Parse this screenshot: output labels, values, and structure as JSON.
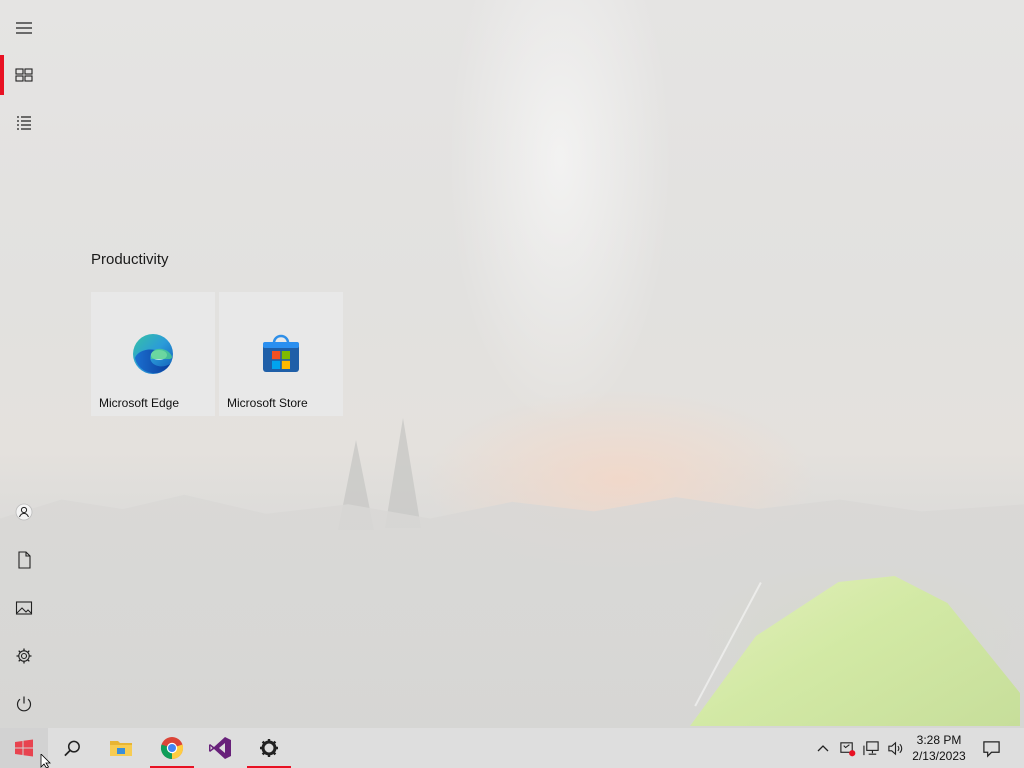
{
  "start_menu": {
    "rail": {
      "items": [
        {
          "name": "Expand",
          "icon": "hamburger-icon"
        },
        {
          "name": "Pinned tiles",
          "icon": "tiles-icon",
          "active": true
        },
        {
          "name": "All apps",
          "icon": "list-icon"
        },
        {
          "name": "Account",
          "icon": "user-icon"
        },
        {
          "name": "Documents",
          "icon": "document-icon"
        },
        {
          "name": "Pictures",
          "icon": "pictures-icon"
        },
        {
          "name": "Settings",
          "icon": "gear-icon"
        },
        {
          "name": "Power",
          "icon": "power-icon"
        }
      ]
    },
    "group": {
      "title": "Productivity",
      "tiles": [
        {
          "label": "Microsoft Edge",
          "icon": "edge-icon"
        },
        {
          "label": "Microsoft Store",
          "icon": "store-icon"
        }
      ]
    }
  },
  "taskbar": {
    "apps": [
      {
        "name": "Start",
        "icon": "windows-logo-icon"
      },
      {
        "name": "Search",
        "icon": "search-icon"
      },
      {
        "name": "File Explorer",
        "icon": "folder-icon"
      },
      {
        "name": "Google Chrome",
        "icon": "chrome-icon",
        "running": true
      },
      {
        "name": "Visual Studio",
        "icon": "visual-studio-icon"
      },
      {
        "name": "Settings",
        "icon": "gear-icon",
        "running": true
      }
    ],
    "tray": {
      "icons": [
        "chevron-up-icon",
        "defender-icon",
        "network-icon",
        "volume-icon"
      ],
      "time": "3:28 PM",
      "date": "2/13/2023",
      "notification_icon": "action-center-icon"
    }
  },
  "colors": {
    "accent": "#e81123",
    "tile_background": "#e8e8e8",
    "taskbar_background": "#dedede"
  }
}
